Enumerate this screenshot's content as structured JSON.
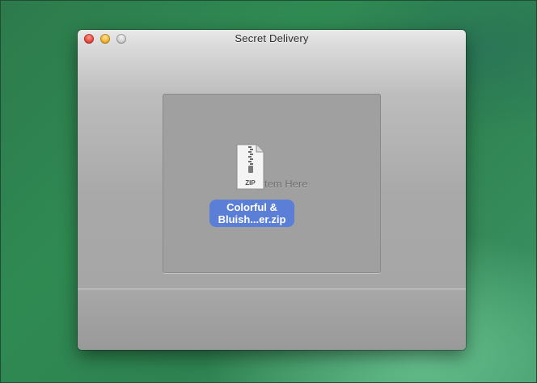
{
  "window": {
    "title": "Secret Delivery"
  },
  "dropzone": {
    "label": "Drop Item Here"
  },
  "dragged_file": {
    "icon_text": "ZIP",
    "name_line1": "Colorful &",
    "name_line2": "Bluish...er.zip"
  },
  "colors": {
    "selection_label": "#5b7fd6",
    "close_button": "#e9463b",
    "minimize_button": "#f2b32a",
    "zoom_button": "#cfcfcf"
  }
}
